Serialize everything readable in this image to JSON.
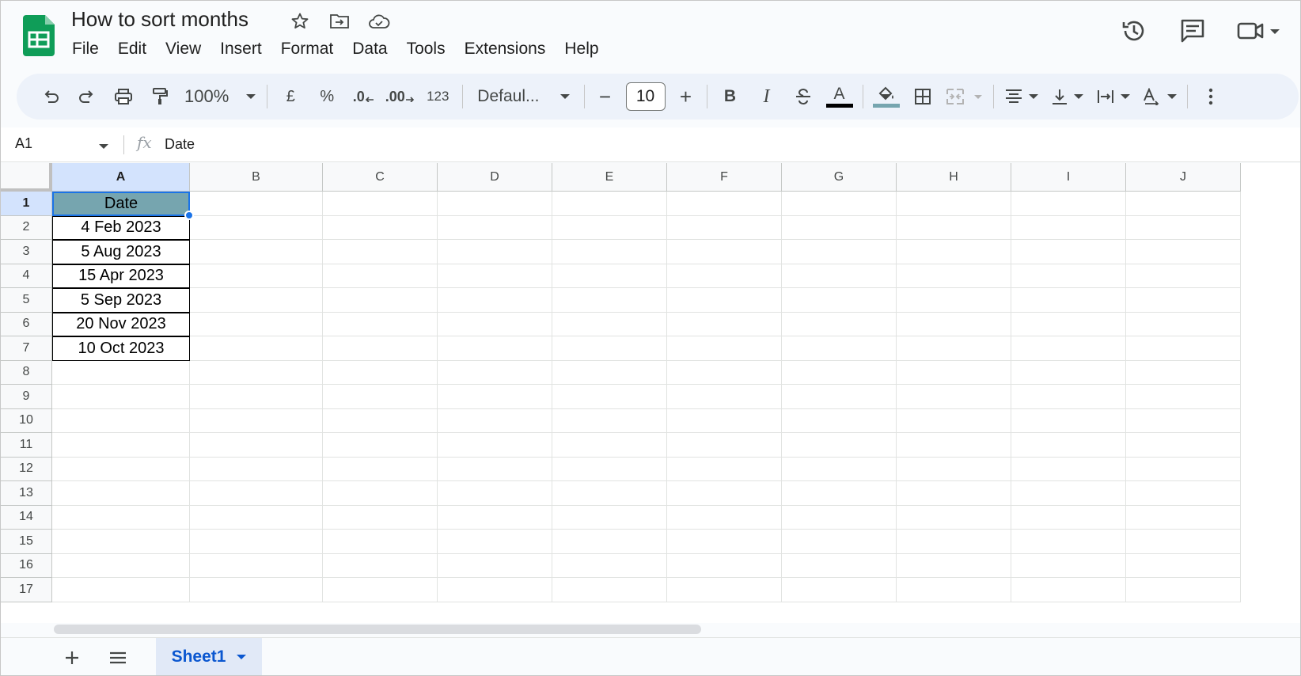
{
  "app": {
    "name": "Google Sheets",
    "logo_color": "#0f9d58"
  },
  "document": {
    "title": "How to sort months"
  },
  "title_icons": [
    "star-icon",
    "move-to-folder-icon",
    "cloud-saved-icon"
  ],
  "menu": [
    "File",
    "Edit",
    "View",
    "Insert",
    "Format",
    "Data",
    "Tools",
    "Extensions",
    "Help"
  ],
  "right_icons": [
    "version-history-icon",
    "comments-icon",
    "meet-camera-icon"
  ],
  "toolbar": {
    "zoom": "100%",
    "currency": "£",
    "percent": "%",
    "decrease_decimal": ".0",
    "increase_decimal": ".00",
    "more_formats": "123",
    "font_name": "Defaul...",
    "font_size": "10",
    "minus": "−",
    "plus": "+",
    "bold": "B",
    "italic": "I",
    "text_color_letter": "A",
    "text_color": "#000000",
    "fill_color": "#76a5af"
  },
  "formula_bar": {
    "cell_ref": "A1",
    "fx": "fx",
    "value": "Date"
  },
  "columns": [
    "A",
    "B",
    "C",
    "D",
    "E",
    "F",
    "G",
    "H",
    "I",
    "J"
  ],
  "rows": [
    "1",
    "2",
    "3",
    "4",
    "5",
    "6",
    "7",
    "8",
    "9",
    "10",
    "11",
    "12",
    "13",
    "14",
    "15",
    "16",
    "17"
  ],
  "table": {
    "header": "Date",
    "header_fill": "#76a5af",
    "values": [
      "4 Feb 2023",
      "5 Aug 2023",
      "15 Apr 2023",
      "5 Sep 2023",
      "20 Nov 2023",
      "10 Oct 2023"
    ]
  },
  "selected_cell": "A1",
  "sheets": [
    {
      "name": "Sheet1",
      "active": true
    }
  ]
}
